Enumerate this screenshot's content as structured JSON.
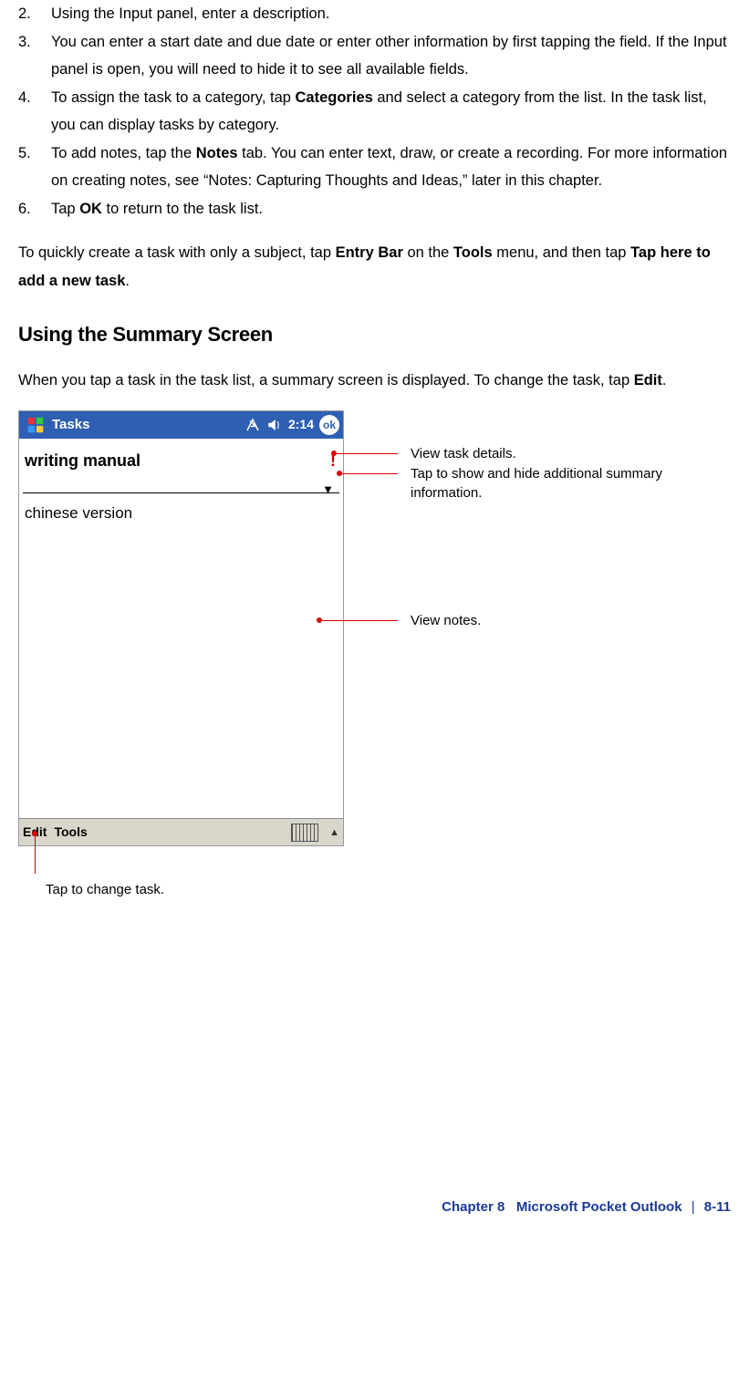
{
  "steps": [
    {
      "num": "2.",
      "parts": [
        "Using the Input panel, enter a description."
      ]
    },
    {
      "num": "3.",
      "parts": [
        "You can enter a start date and due date or enter other information by first tapping the field. If the Input panel is open, you will need to hide it to see all available fields."
      ]
    },
    {
      "num": "4.",
      "pre": "To assign the task to a category, tap ",
      "b1": "Categories",
      "post": " and select a category from the list. In the task list, you can display tasks by category."
    },
    {
      "num": "5.",
      "pre": "To add notes, tap the ",
      "b1": "Notes",
      "post": " tab. You can enter text, draw, or create a recording. For more information on creating notes, see “Notes: Capturing Thoughts and Ideas,” later in this chapter."
    },
    {
      "num": "6.",
      "pre": "Tap ",
      "b1": "OK",
      "post": " to return to the task list."
    }
  ],
  "quick_para": {
    "pre": "To quickly create a task with only a subject, tap ",
    "b1": "Entry Bar",
    "mid1": " on the ",
    "b2": "Tools",
    "mid2": " menu, and then tap ",
    "b3": "Tap here to add a new task",
    "post": "."
  },
  "section_heading": "Using the Summary Screen",
  "section_para": {
    "pre": "When you tap a task in the task list, a summary screen is displayed. To change the task, tap ",
    "b1": "Edit",
    "post": "."
  },
  "device": {
    "app_title": "Tasks",
    "clock": "2:14",
    "ok": "ok",
    "task_title": "writing manual",
    "notes": "chinese version",
    "menu_edit": "Edit",
    "menu_tools": "Tools"
  },
  "callouts": {
    "view_details": "View task details.",
    "show_hide": "Tap to show and hide additional summary information.",
    "view_notes": "View notes.",
    "change_task": "Tap to change task."
  },
  "footer": {
    "chapter": "Chapter 8",
    "title": "Microsoft Pocket Outlook",
    "page": "8-11"
  }
}
